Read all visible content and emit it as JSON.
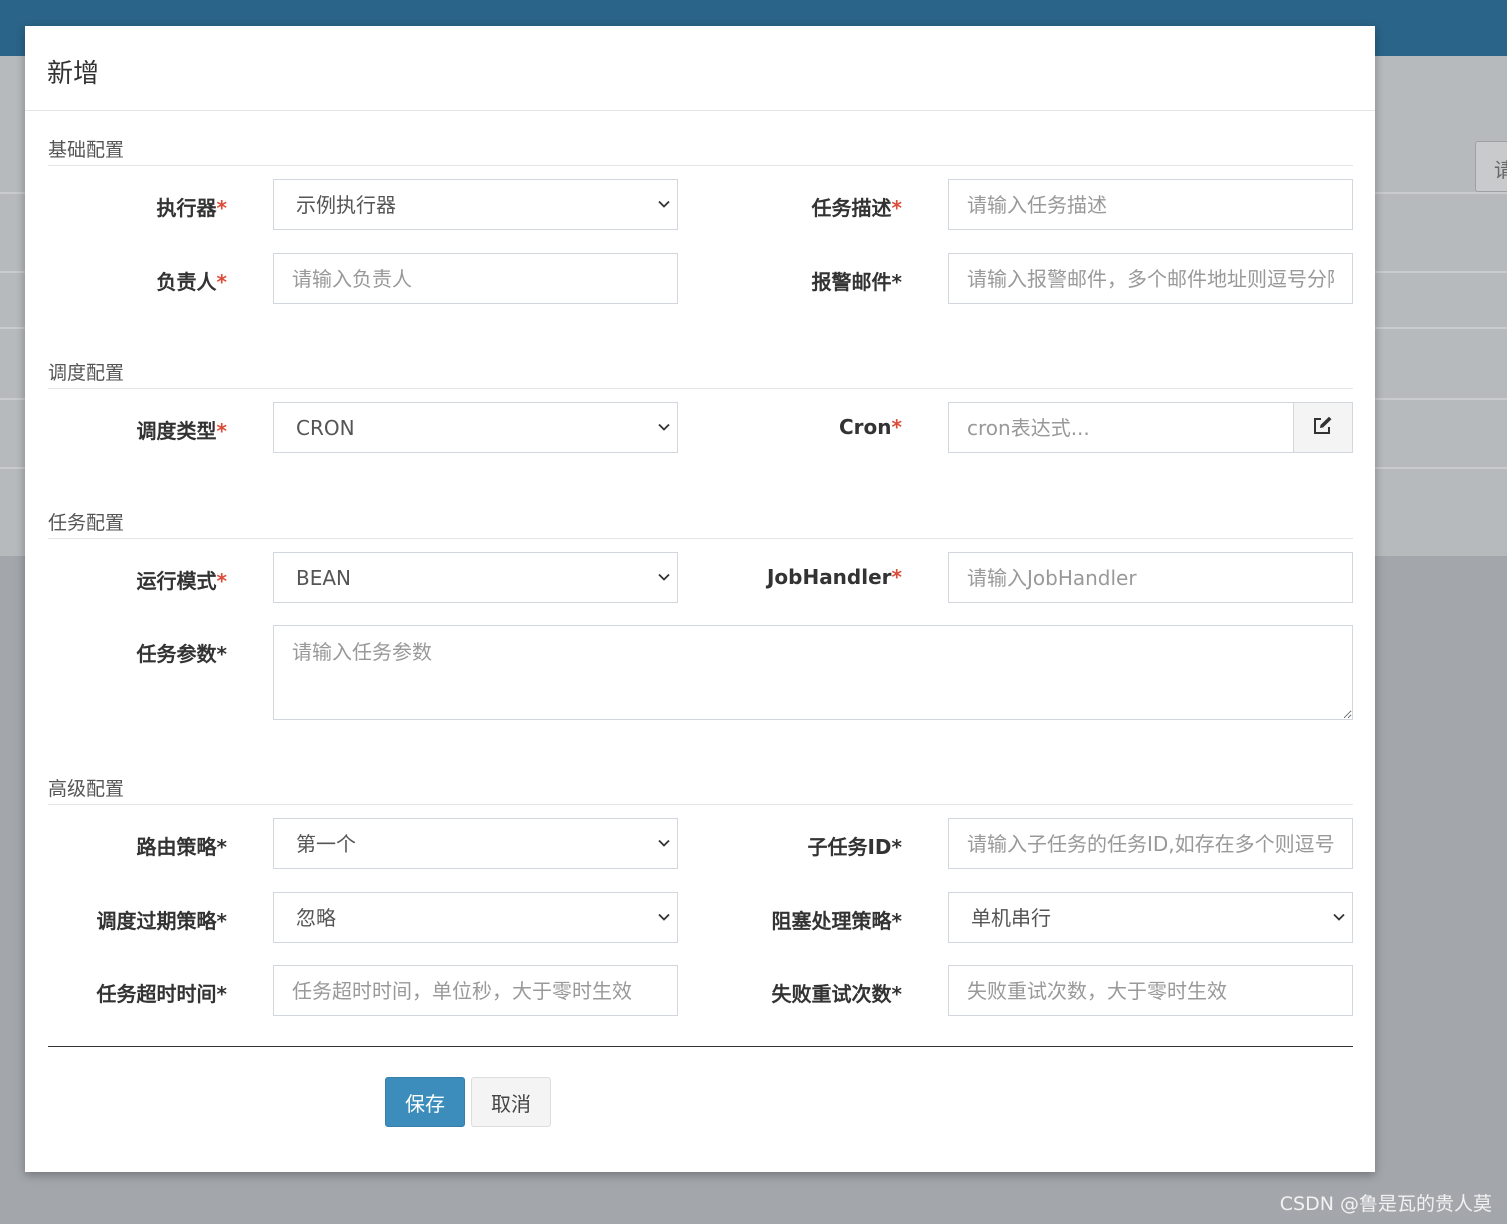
{
  "modal": {
    "title": "新增",
    "save_label": "保存",
    "cancel_label": "取消"
  },
  "background": {
    "right_button_text": "请"
  },
  "sections": {
    "basic": "基础配置",
    "schedule": "调度配置",
    "task": "任务配置",
    "advanced": "高级配置"
  },
  "fields": {
    "executor": {
      "label": "执行器",
      "required_mark": "*",
      "value": "示例执行器",
      "options": [
        "示例执行器"
      ]
    },
    "job_desc": {
      "label": "任务描述",
      "required_mark": "*",
      "placeholder": "请输入任务描述"
    },
    "author": {
      "label": "负责人",
      "required_mark": "*",
      "placeholder": "请输入负责人"
    },
    "alarm_email": {
      "label": "报警邮件*",
      "placeholder": "请输入报警邮件，多个邮件地址则逗号分隔"
    },
    "schedule_type": {
      "label": "调度类型",
      "required_mark": "*",
      "value": "CRON",
      "options": [
        "CRON"
      ]
    },
    "cron": {
      "label": "Cron",
      "required_mark": "*",
      "placeholder": "cron表达式..."
    },
    "run_mode": {
      "label": "运行模式",
      "required_mark": "*",
      "value": "BEAN",
      "options": [
        "BEAN"
      ]
    },
    "job_handler": {
      "label": "JobHandler",
      "required_mark": "*",
      "placeholder": "请输入JobHandler"
    },
    "job_param": {
      "label": "任务参数*",
      "placeholder": "请输入任务参数"
    },
    "route_strategy": {
      "label": "路由策略*",
      "value": "第一个",
      "options": [
        "第一个"
      ]
    },
    "child_job_id": {
      "label": "子任务ID*",
      "placeholder": "请输入子任务的任务ID,如存在多个则逗号分隔"
    },
    "misfire_strategy": {
      "label": "调度过期策略*",
      "value": "忽略",
      "options": [
        "忽略"
      ]
    },
    "block_strategy": {
      "label": "阻塞处理策略*",
      "value": "单机串行",
      "options": [
        "单机串行"
      ]
    },
    "timeout": {
      "label": "任务超时时间*",
      "placeholder": "任务超时时间，单位秒，大于零时生效"
    },
    "fail_retry": {
      "label": "失败重试次数*",
      "placeholder": "失败重试次数，大于零时生效"
    }
  },
  "watermark": "CSDN @鲁是瓦的贵人莫",
  "colors": {
    "topbar": "#2a6488",
    "primary": "#3c8dbc",
    "required": "#dd4b39"
  }
}
